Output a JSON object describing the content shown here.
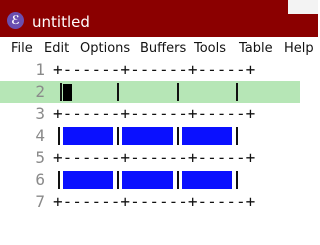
{
  "window": {
    "title": "untitled",
    "icon": "emacs-icon"
  },
  "menubar": {
    "items": [
      "File",
      "Edit",
      "Options",
      "Buffers",
      "Tools",
      "Table",
      "Help"
    ]
  },
  "editor": {
    "lines": [
      {
        "num": "1",
        "text": "+------+------+-----+"
      },
      {
        "num": "2",
        "text": ""
      },
      {
        "num": "3",
        "text": "+------+------+-----+"
      },
      {
        "num": "4",
        "text": ""
      },
      {
        "num": "5",
        "text": "+------+------+-----+"
      },
      {
        "num": "6",
        "text": ""
      },
      {
        "num": "7",
        "text": "+------+------+-----+"
      }
    ],
    "highlight_color": "#b6e6b6",
    "cell_fill_color": "#0a10ff"
  }
}
